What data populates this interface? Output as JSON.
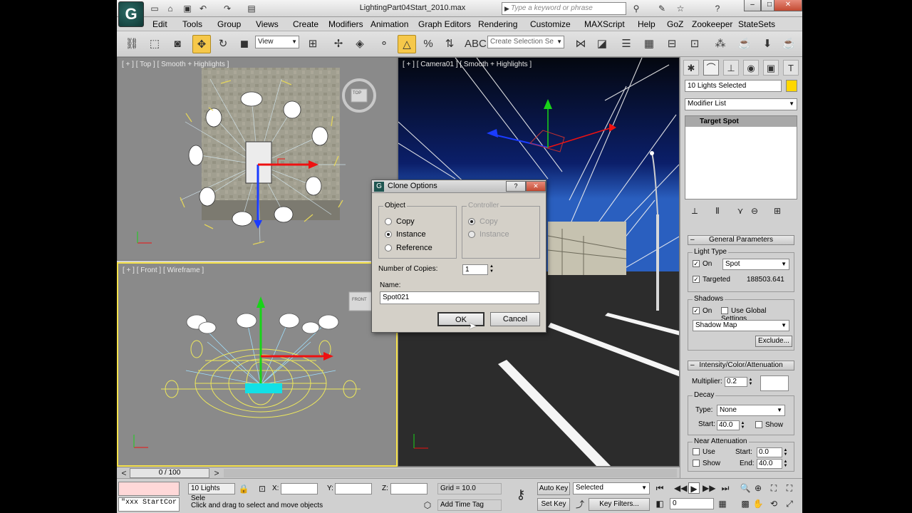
{
  "window": {
    "title": "LightingPart04Start_2010.max",
    "search_placeholder": "Type a keyword or phrase",
    "logo_letter": "G"
  },
  "menu": [
    "Edit",
    "Tools",
    "Group",
    "Views",
    "Create",
    "Modifiers",
    "Animation",
    "Graph Editors",
    "Rendering",
    "Customize",
    "MAXScript",
    "Help",
    "GoZ",
    "Zookeeper",
    "StateSets"
  ],
  "toolbar": {
    "ref_coord": "View",
    "selection_set_placeholder": "Create Selection Se",
    "snap_angle_label": "2.5"
  },
  "viewports": {
    "top": {
      "label": "[ + ] [ Top ] [ Smooth + Highlights ]",
      "cube": "TOP"
    },
    "camera": {
      "label": "[ + ] [ Camera01 ] [ Smooth + Highlights ]"
    },
    "front": {
      "label": "[ + ] [ Front ] [ Wireframe ]",
      "cube": "FRONT"
    }
  },
  "dialog": {
    "title": "Clone Options",
    "object_group": "Object",
    "object_options": [
      "Copy",
      "Instance",
      "Reference"
    ],
    "object_selected": "Instance",
    "controller_group": "Controller",
    "controller_options": [
      "Copy",
      "Instance"
    ],
    "copies_label": "Number of Copies:",
    "copies_value": "1",
    "name_label": "Name:",
    "name_value": "Spot021",
    "ok": "OK",
    "cancel": "Cancel"
  },
  "command_panel": {
    "selection_name": "10 Lights Selected",
    "selection_color": "#ffd700",
    "modifier_list": "Modifier List",
    "stack_item": "Target Spot",
    "general_parameters": "General Parameters",
    "light_type_label": "Light Type",
    "on_label": "On",
    "light_type": "Spot",
    "targeted_label": "Targeted",
    "target_distance": "188503.641",
    "shadows_label": "Shadows",
    "use_global_label": "Use Global Settings",
    "shadow_type": "Shadow Map",
    "exclude": "Exclude...",
    "intensity_rollout": "Intensity/Color/Attenuation",
    "multiplier_label": "Multiplier:",
    "multiplier": "0.2",
    "decay_label": "Decay",
    "type_label": "Type:",
    "decay_type": "None",
    "start_label": "Start:",
    "decay_start": "40.0",
    "show_label": "Show",
    "near_atten_label": "Near Attenuation",
    "use_label": "Use",
    "near_start": "0.0",
    "end_label": "End:",
    "near_end": "40.0"
  },
  "timeline": {
    "frame": "0 / 100",
    "prev": "<",
    "next": ">"
  },
  "status": {
    "maxscript": "\"xxx StartCor",
    "selection": "10 Lights Sele",
    "prompt": "Click and drag to select and move objects",
    "x_label": "X:",
    "y_label": "Y:",
    "z_label": "Z:",
    "grid": "Grid = 10.0",
    "add_time_tag": "Add Time Tag",
    "auto_key": "Auto Key",
    "set_key": "Set Key",
    "key_mode": "Selected",
    "key_filters": "Key Filters...",
    "frame_field": "0"
  }
}
